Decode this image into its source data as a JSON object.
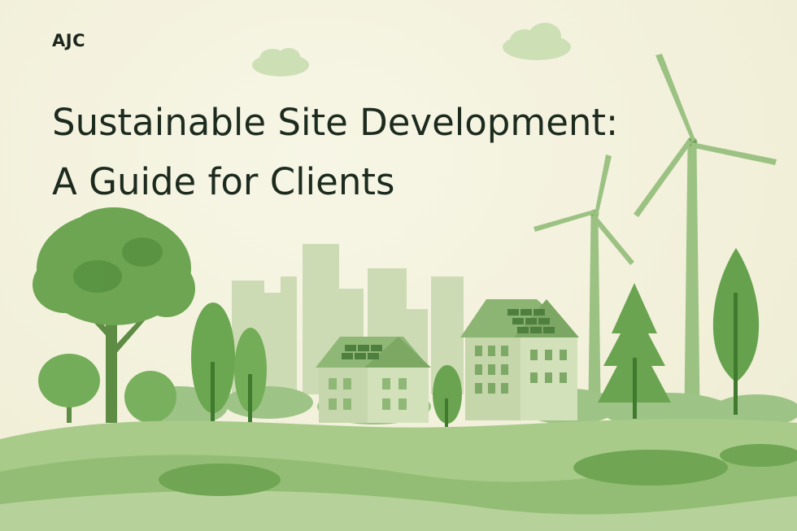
{
  "brand": {
    "logo_text": "AJC"
  },
  "hero": {
    "title_line_1": "Sustainable Site Development:",
    "title_line_2": "A Guide for Clients"
  },
  "colors": {
    "background": "#f3f1dc",
    "text": "#1d2b1f",
    "green_dark": "#3f7a2e",
    "green_mid": "#6aa14f",
    "green_light": "#a9c98f",
    "green_pale": "#c9dbb0"
  },
  "illustration": {
    "icons": [
      "cloud-icon",
      "wind-turbine-icon",
      "tree-icon",
      "house-icon",
      "solar-panel-icon",
      "city-skyline-icon"
    ]
  }
}
